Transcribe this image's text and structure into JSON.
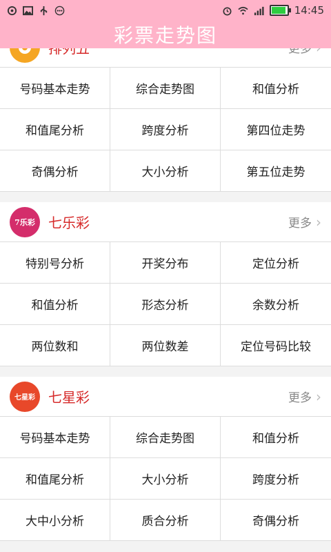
{
  "status_bar": {
    "time": "14:45",
    "icons": [
      "sync-icon",
      "image-icon",
      "usb-icon",
      "more-icon"
    ],
    "right_icons": [
      "alarm-icon",
      "wifi-icon",
      "signal-icon"
    ],
    "battery_level": 0.85
  },
  "title": "彩票走势图",
  "colors": {
    "header_bg": "#ffb3c9",
    "accent_red": "#d62a2a",
    "pl5_logo": "#f5a623",
    "ql_logo": "#d42d6b",
    "qx_logo": "#e8482a"
  },
  "sections": [
    {
      "name": "排列五",
      "logo": "",
      "more": "更多",
      "items": [
        "号码基本走势",
        "综合走势图",
        "和值分析",
        "和值尾分析",
        "跨度分析",
        "第四位走势",
        "奇偶分析",
        "大小分析",
        "第五位走势"
      ]
    },
    {
      "name": "七乐彩",
      "logo": "7乐彩",
      "more": "更多",
      "items": [
        "特别号分析",
        "开奖分布",
        "定位分析",
        "和值分析",
        "形态分析",
        "余数分析",
        "两位数和",
        "两位数差",
        "定位号码比较"
      ]
    },
    {
      "name": "七星彩",
      "logo": "七星彩",
      "more": "更多",
      "items": [
        "号码基本走势",
        "综合走势图",
        "和值分析",
        "和值尾分析",
        "大小分析",
        "跨度分析",
        "大中小分析",
        "质合分析",
        "奇偶分析"
      ]
    }
  ]
}
